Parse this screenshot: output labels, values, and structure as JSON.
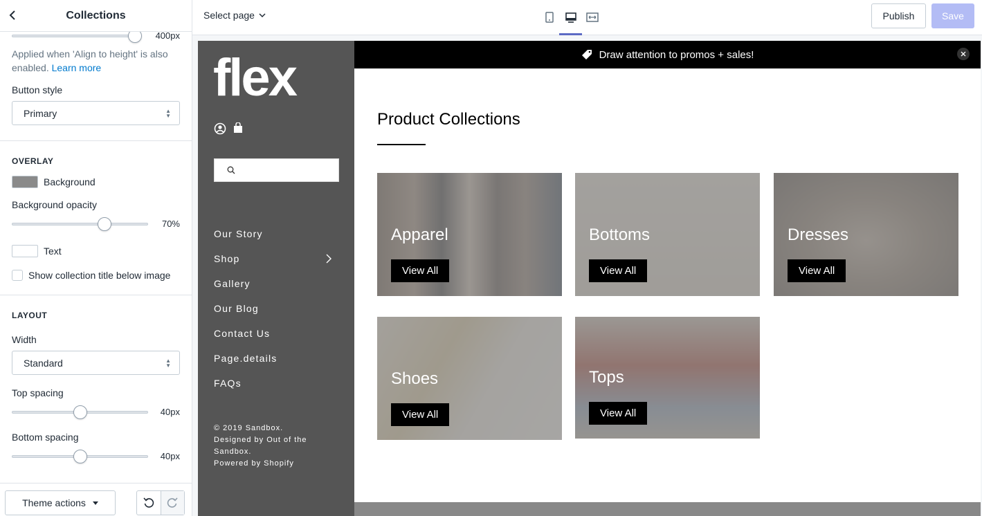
{
  "sidebar": {
    "title": "Collections",
    "top_slider_value": "400px",
    "help_text": "Applied when 'Align to height' is also enabled.",
    "help_link": "Learn more",
    "button_style_label": "Button style",
    "button_style_value": "Primary",
    "overlay_heading": "OVERLAY",
    "background_label": "Background",
    "background_color": "#8a8a8a",
    "background_opacity_label": "Background opacity",
    "background_opacity_value": "70%",
    "text_label": "Text",
    "text_color": "#ffffff",
    "show_title_label": "Show collection title below image",
    "layout_heading": "LAYOUT",
    "width_label": "Width",
    "width_value": "Standard",
    "top_spacing_label": "Top spacing",
    "top_spacing_value": "40px",
    "bottom_spacing_label": "Bottom spacing",
    "bottom_spacing_value": "40px",
    "theme_actions_label": "Theme actions"
  },
  "topbar": {
    "select_page": "Select page",
    "publish": "Publish",
    "save": "Save"
  },
  "store": {
    "logo": "flex",
    "nav": [
      "Our Story",
      "Shop",
      "Gallery",
      "Our Blog",
      "Contact Us",
      "Page.details",
      "FAQs"
    ],
    "footer": [
      "© 2019 Sandbox.",
      "Designed by Out of the",
      "Sandbox.",
      "Powered by Shopify"
    ],
    "announcement": "Draw attention to promos + sales!",
    "section_title": "Product Collections",
    "collections": [
      {
        "title": "Apparel",
        "button": "View All"
      },
      {
        "title": "Bottoms",
        "button": "View All"
      },
      {
        "title": "Dresses",
        "button": "View All"
      },
      {
        "title": "Shoes",
        "button": "View All"
      },
      {
        "title": "Tops",
        "button": "View All"
      }
    ]
  },
  "colors": {
    "accent": "#5c6ac4",
    "save_disabled": "#b3bcf5",
    "link": "#007ace",
    "store_sidebar": "#555555"
  }
}
